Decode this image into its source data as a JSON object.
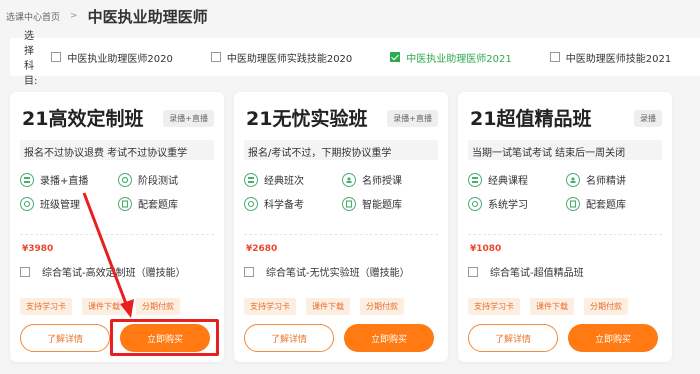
{
  "breadcrumb": {
    "home": "选课中心首页",
    "sep": ">",
    "current": "中医执业助理医师"
  },
  "filter": {
    "label": "选择科目:",
    "options": [
      {
        "label": "中医执业助理医师2020",
        "checked": false
      },
      {
        "label": "中医助理医师实践技能2020",
        "checked": false
      },
      {
        "label": "中医执业助理医师2021",
        "checked": true
      },
      {
        "label": "中医助理医师技能2021",
        "checked": false
      }
    ]
  },
  "colors": {
    "accent": "#ff7a12",
    "price": "#e94b2b",
    "checked": "#2eaa4e",
    "highlight": "#e81f1f",
    "icon": "#4caf6e"
  },
  "cards": [
    {
      "title": "21高效定制班",
      "tag": "录播+直播",
      "desc": "报名不过协议退费 考试不过协议重学",
      "features": [
        {
          "label": "录播+直播",
          "icon": "layers-icon"
        },
        {
          "label": "阶段测试",
          "icon": "test-icon"
        },
        {
          "label": "班级管理",
          "icon": "refresh-icon"
        },
        {
          "label": "配套题库",
          "icon": "book-icon"
        }
      ],
      "price": "¥3980",
      "combo": "综合笔试-高效定制班（赠技能）",
      "chips": [
        "支持学习卡",
        "课件下载",
        "分期付款"
      ],
      "detail_label": "了解详情",
      "buy_label": "立即购买"
    },
    {
      "title": "21无忧实验班",
      "tag": "录播+直播",
      "desc": "报名/考试不过，下期按协议重学",
      "features": [
        {
          "label": "经典班次",
          "icon": "layers-icon"
        },
        {
          "label": "名师授课",
          "icon": "teacher-icon"
        },
        {
          "label": "科学备考",
          "icon": "refresh-icon"
        },
        {
          "label": "智能题库",
          "icon": "book-icon"
        }
      ],
      "price": "¥2680",
      "combo": "综合笔试-无忧实验班（赠技能）",
      "chips": [
        "支持学习卡",
        "课件下载",
        "分期付款"
      ],
      "detail_label": "了解详情",
      "buy_label": "立即购买"
    },
    {
      "title": "21超值精品班",
      "tag": "录播",
      "desc": "当期一试笔试考试 结束后一周关闭",
      "features": [
        {
          "label": "经典课程",
          "icon": "layers-icon"
        },
        {
          "label": "名师精讲",
          "icon": "teacher-icon"
        },
        {
          "label": "系统学习",
          "icon": "refresh-icon"
        },
        {
          "label": "配套题库",
          "icon": "book-icon"
        }
      ],
      "price": "¥1080",
      "combo": "综合笔试-超值精品班",
      "chips": [
        "支持学习卡",
        "课件下载",
        "分期付款"
      ],
      "detail_label": "了解详情",
      "buy_label": "立即购买"
    }
  ]
}
